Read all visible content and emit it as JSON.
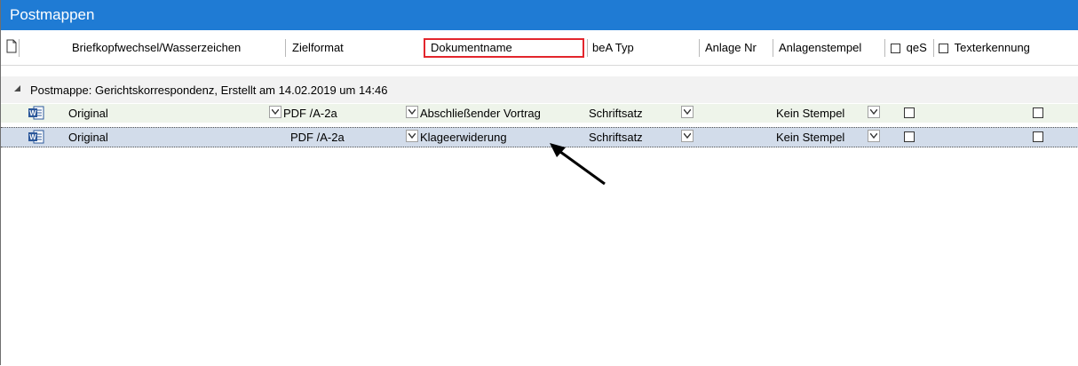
{
  "title": "Postmappen",
  "columns": {
    "doc_icon": "document-icon",
    "briefkopf": "Briefkopfwechsel/Wasserzeichen",
    "zielformat": "Zielformat",
    "dokumentname": "Dokumentname",
    "bea_typ": "beA Typ",
    "anlage_nr": "Anlage Nr",
    "anlagenstempel": "Anlagenstempel",
    "qes": "qeS",
    "texterkennung": "Texterkennung"
  },
  "group": {
    "label": "Postmappe: Gerichtskorrespondenz, Erstellt am 14.02.2019 um 14:46"
  },
  "rows": [
    {
      "icon": "word-document-icon",
      "briefkopf": "Original",
      "zielformat": "PDF /A-2a",
      "dokumentname": "Abschließender Vortrag",
      "bea_typ": "Schriftsatz",
      "anlagenstempel": "Kein Stempel",
      "qes": false,
      "texterkennung": false
    },
    {
      "icon": "word-document-icon",
      "briefkopf": "Original",
      "zielformat": "PDF /A-2a",
      "dokumentname": "Klageerwiderung",
      "bea_typ": "Schriftsatz",
      "anlagenstempel": "Kein Stempel",
      "qes": false,
      "texterkennung": false
    }
  ],
  "colors": {
    "titlebar": "#1f7bd4",
    "highlight": "#e3262d",
    "selected_row": "#d2dcea",
    "first_row": "#eef4ea"
  }
}
